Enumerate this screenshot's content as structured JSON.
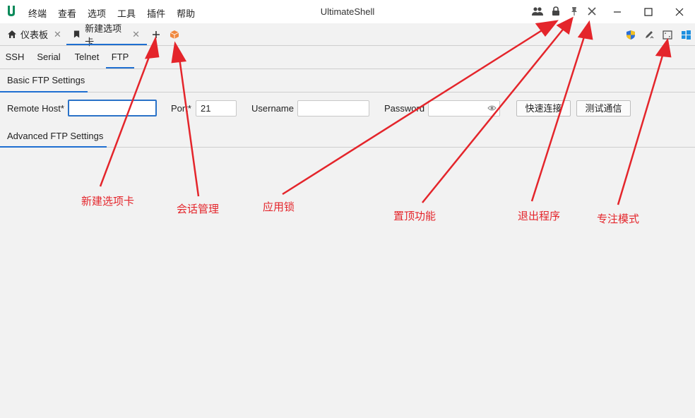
{
  "app": {
    "title": "UltimateShell",
    "logo": "U"
  },
  "menu": [
    "终端",
    "查看",
    "选项",
    "工具",
    "插件",
    "帮助"
  ],
  "title_icons": [
    "users-icon",
    "lock-icon",
    "pin-icon",
    "close-icon"
  ],
  "window_controls": [
    "minimize-icon",
    "maximize-icon",
    "close-icon"
  ],
  "tabs": [
    {
      "label": "仪表板",
      "icon": "home-icon",
      "closable": true
    },
    {
      "label": "新建选项卡",
      "icon": "bookmark-icon",
      "closable": true,
      "active": true
    }
  ],
  "tabbar_right_icons": [
    "shield-icon",
    "edit-tool-icon",
    "focus-mode-icon",
    "windows-icon"
  ],
  "protocols": [
    "SSH",
    "Serial",
    "Telnet",
    "FTP"
  ],
  "active_protocol": "FTP",
  "basic_section": "Basic FTP Settings",
  "advanced_section": "Advanced FTP Settings",
  "form": {
    "remote_host_label": "Remote Host*",
    "remote_host_value": "",
    "port_label": "Port*",
    "port_value": "21",
    "username_label": "Username",
    "username_value": "",
    "password_label": "Password",
    "password_value": "",
    "quick_connect": "快速连接",
    "test_connection": "测试通信"
  },
  "annotations": {
    "new_tab": "新建选项卡",
    "session_mgmt": "会话管理",
    "app_lock": "应用锁",
    "pin_top": "置顶功能",
    "exit": "退出程序",
    "focus_mode": "专注模式"
  },
  "colors": {
    "accent": "#1f6fd1",
    "annotation": "#e4252b",
    "logo": "#0a8a5a",
    "session_icon": "#f0883e"
  }
}
